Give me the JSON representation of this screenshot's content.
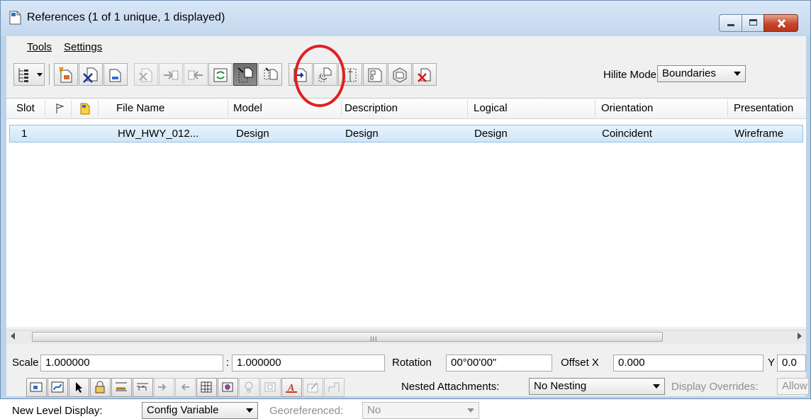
{
  "window": {
    "title": "References (1 of 1 unique, 1 displayed)",
    "buttons": {
      "minimize": "minimize",
      "maximize": "maximize",
      "close": "close"
    },
    "colors": {
      "close_red": "#c7442a",
      "highlight_circle": "#e02020",
      "row_selection": "#cfe6f8"
    }
  },
  "menu": {
    "items": [
      "Tools",
      "Settings"
    ]
  },
  "toolbar": {
    "tools": [
      "tree-list-icon",
      "attach-reference-icon",
      "detach-reference-icon",
      "reload-reference-icon",
      "exchange-reference-icon",
      "move-reference-icon",
      "copy-reference-icon",
      "rotate-reference-icon",
      "scale-reference-icon",
      "mirror-horizontal-icon",
      "mirror-vertical-icon",
      "clip-boundary-icon",
      "clip-mask-icon",
      "delete-clip-icon",
      "make-direct-attachment-icon",
      "clip-front-icon",
      "display-3d-icon",
      "delete-icon"
    ],
    "hilite_label": "Hilite Mode:",
    "hilite_value": "Boundaries"
  },
  "table": {
    "columns": [
      "Slot",
      "",
      "",
      "File Name",
      "Model",
      "Description",
      "Logical",
      "Orientation",
      "Presentation"
    ],
    "rows": [
      {
        "slot": "1",
        "file_name": "HW_HWY_012...",
        "model": "Design",
        "description": "Design",
        "logical": "Design",
        "orientation": "Coincident",
        "presentation": "Wireframe"
      }
    ],
    "scroll_grip": "III"
  },
  "properties": {
    "scale_label": "Scale",
    "scale_1": "1.000000",
    "scale_sep": ":",
    "scale_2": "1.000000",
    "rotation_label": "Rotation",
    "rotation_value": "00°00'00\"",
    "offset_x_label": "Offset X",
    "offset_x_value": "0.000",
    "y_label": "Y",
    "y_value": "0.0"
  },
  "display": {
    "tools": [
      "display-toggle-icon",
      "snap-toggle-icon",
      "locate-toggle-icon",
      "lock-toggle-icon",
      "true-scale-toggle-icon",
      "scale-line-styles-icon",
      "treat-as-element-icon",
      "ignore-attachment-icon",
      "raster-toggle-icon",
      "color-adjust-icon",
      "lights-toggle-icon",
      "levels-toggle-icon",
      "text-style-icon",
      "colors-icon",
      "use-lights-icon"
    ],
    "nested_label": "Nested Attachments:",
    "nested_value": "No Nesting",
    "overrides_label": "Display Overrides:",
    "overrides_value": "Allow",
    "new_level_label": "New Level Display:",
    "new_level_value": "Config Variable",
    "georef_label": "Georeferenced:",
    "georef_value": "No"
  }
}
